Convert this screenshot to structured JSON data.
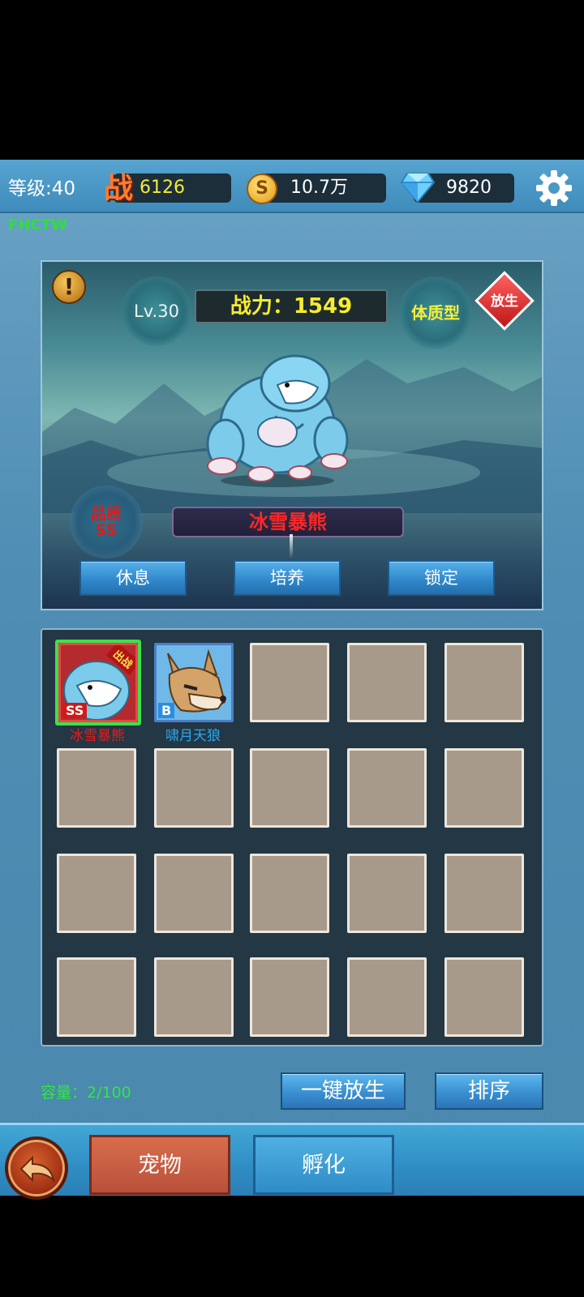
{
  "top_bar": {
    "level": "等级:40",
    "power_icon": "战",
    "power": "6126",
    "coin_icon": "S",
    "coins": "10.7万",
    "gems": "9820",
    "watermark": "FHCTW"
  },
  "showcase": {
    "alert_icon": "!",
    "level": "Lv.30",
    "combat_power": "战力：1549",
    "type": "体质型",
    "release": "放生",
    "quality_label": "品质",
    "quality": "SS",
    "pet_name": "冰雪暴熊",
    "buttons": {
      "rest": "休息",
      "train": "培养",
      "lock": "锁定"
    }
  },
  "pets": [
    {
      "name": "冰雪暴熊",
      "grade": "SS",
      "badge": "出战",
      "name_color": "#e02020"
    },
    {
      "name": "啸月天狼",
      "grade": "B",
      "badge": "",
      "name_color": "#2aa8f0"
    }
  ],
  "capacity": "容量：2/100",
  "actions": {
    "release_all": "一键放生",
    "sort": "排序"
  },
  "nav": {
    "pets_tab": "宠物",
    "hatch_tab": "孵化"
  }
}
